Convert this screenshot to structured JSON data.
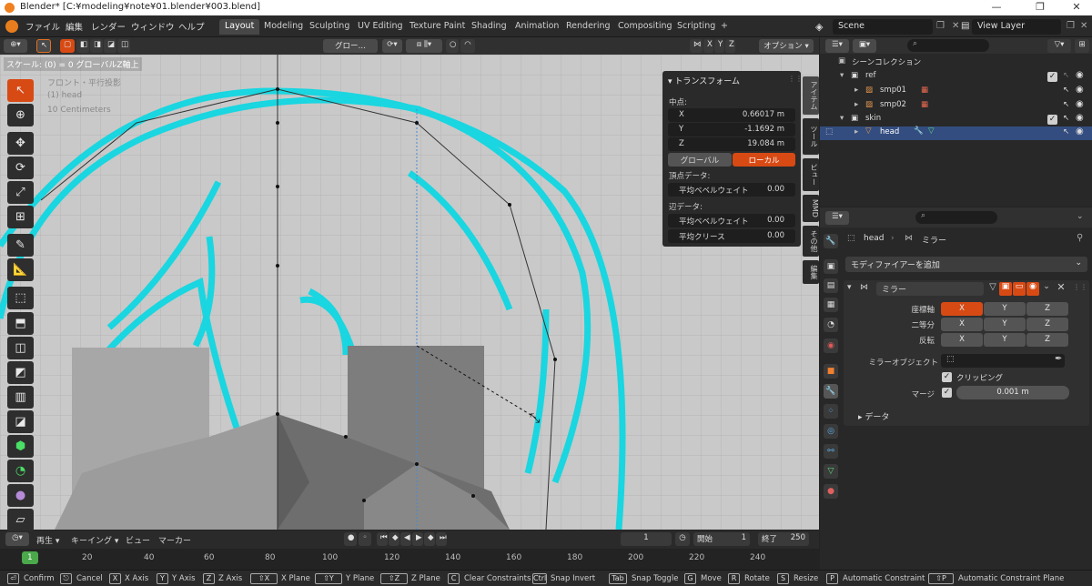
{
  "window": {
    "title": "Blender* [C:¥modeling¥note¥01.blender¥003.blend]",
    "minimize": "—",
    "maximize": "❐",
    "close": "✕"
  },
  "menu": [
    "ファイル",
    "編集",
    "レンダー",
    "ウィンドウ",
    "ヘルプ"
  ],
  "workspaces": [
    "Layout",
    "Modeling",
    "Sculpting",
    "UV Editing",
    "Texture Paint",
    "Shading",
    "Animation",
    "Rendering",
    "Compositing",
    "Scripting"
  ],
  "workspace_active": "Layout",
  "add_workspace": "+",
  "scene": {
    "name": "Scene",
    "view_layer": "View Layer"
  },
  "viewport_header": {
    "transform_orientation": "グロー…",
    "axis_x": "X",
    "axis_y": "Y",
    "axis_z": "Z",
    "options": "オプション ▾"
  },
  "viewport": {
    "operator_hint": "スケール: (0) = 0  グローバルZ軸上",
    "view_name": "フロント・平行投影",
    "object_name": "(1) head",
    "grid_scale": "10 Centimeters"
  },
  "npanel": {
    "header": "トランスフォーム",
    "median_label": "中点:",
    "x_label": "X",
    "x_value": "0.66017 m",
    "y_label": "Y",
    "y_value": "-1.1692 m",
    "z_label": "Z",
    "z_value": "19.084 m",
    "global_btn": "グローバル",
    "local_btn": "ローカル",
    "vertex_data": "頂点データ:",
    "vertex_bevel_label": "平均ベベルウェイト",
    "vertex_bevel_value": "0.00",
    "edge_data": "辺データ:",
    "edge_bevel_label": "平均ベベルウェイト",
    "edge_bevel_value": "0.00",
    "crease_label": "平均クリース",
    "crease_value": "0.00",
    "tabs": [
      "アイテム",
      "ツール",
      "ビュー",
      "MMD",
      "その他",
      "編集"
    ]
  },
  "timeline": {
    "playback": "再生 ▾",
    "keying": "キーイング ▾",
    "view": "ビュー",
    "marker": "マーカー",
    "current_frame": "1",
    "start_label": "開始",
    "start_value": "1",
    "end_label": "終了",
    "end_value": "250",
    "ticks": [
      "1",
      "20",
      "40",
      "60",
      "80",
      "100",
      "120",
      "140",
      "160",
      "180",
      "200",
      "220",
      "240"
    ]
  },
  "statusbar": [
    {
      "key": "⏎",
      "label": "Confirm"
    },
    {
      "key": "⎋",
      "label": "Cancel"
    },
    {
      "key": "X",
      "label": "X Axis"
    },
    {
      "key": "Y",
      "label": "Y Axis"
    },
    {
      "key": "Z",
      "label": "Z Axis"
    },
    {
      "key": "⇧X",
      "label": "X Plane"
    },
    {
      "key": "⇧Y",
      "label": "Y Plane"
    },
    {
      "key": "⇧Z",
      "label": "Z Plane"
    },
    {
      "key": "C",
      "label": "Clear Constraints"
    },
    {
      "key": "Ctrl",
      "label": "Snap Invert"
    },
    {
      "key": "Tab",
      "label": "Snap Toggle"
    },
    {
      "key": "G",
      "label": "Move"
    },
    {
      "key": "R",
      "label": "Rotate"
    },
    {
      "key": "S",
      "label": "Resize"
    },
    {
      "key": "P",
      "label": "Automatic Constraint"
    },
    {
      "key": "⇧P",
      "label": "Automatic Constraint Plane"
    }
  ],
  "outliner": {
    "root": "シーンコレクション",
    "items": [
      {
        "name": "ref",
        "type": "collection"
      },
      {
        "name": "smp01",
        "type": "image"
      },
      {
        "name": "smp02",
        "type": "image"
      },
      {
        "name": "skin",
        "type": "collection"
      },
      {
        "name": "head",
        "type": "mesh"
      }
    ]
  },
  "properties": {
    "object": "head",
    "modifier_crumb": "ミラー",
    "add_modifier": "モディファイアーを追加",
    "modifier_name": "ミラー",
    "axis_label": "座標軸",
    "bisect_label": "二等分",
    "flip_label": "反転",
    "x": "X",
    "y": "Y",
    "z": "Z",
    "mirror_object_label": "ミラーオブジェクト",
    "clipping_label": "クリッピング",
    "merge_label": "マージ",
    "merge_value": "0.001 m",
    "data_label": "データ"
  },
  "colors": {
    "accent": "#d84a14",
    "cyan": "#19d6e0",
    "viewport_bg": "#c9c9c9"
  }
}
